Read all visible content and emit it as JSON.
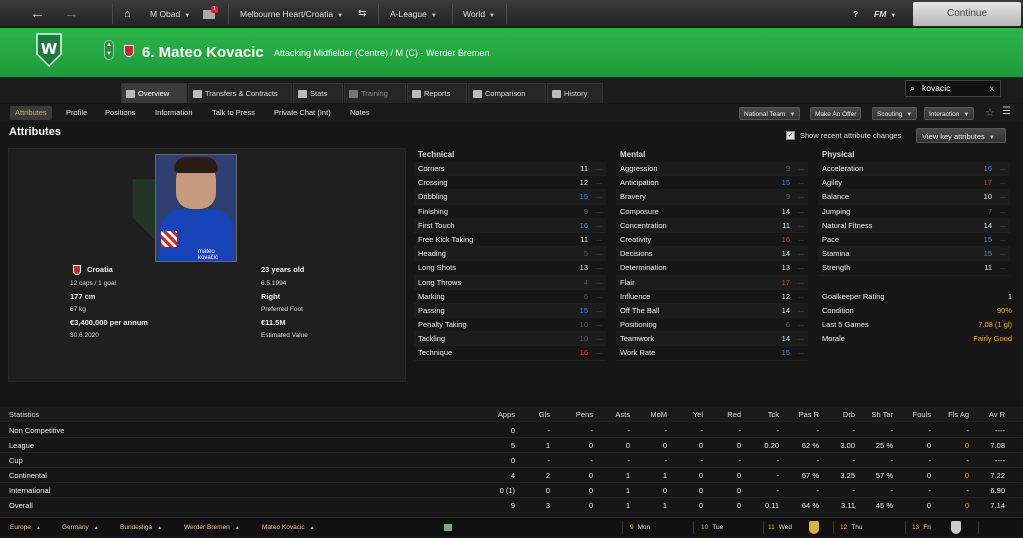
{
  "topbar": {
    "manager": "M Obad",
    "notif_count": "1",
    "club": "Melbourne Heart/Croatia",
    "competition": "A-League",
    "world": "World",
    "help": "?",
    "fm": "FM",
    "continue_label": "Continue"
  },
  "header": {
    "title": "6. Mateo Kovacic",
    "role": "Attacking Midfielder (Centre) / M (C) - Werder Bremen"
  },
  "tabs": [
    "Overview",
    "Transfers & Contracts",
    "Stats",
    "Training",
    "Reports",
    "Comparison",
    "History"
  ],
  "search": {
    "value": "kovacic",
    "clear": "x"
  },
  "subnav": [
    "Attributes",
    "Profile",
    "Positions",
    "Information",
    "Talk to Press",
    "Private Chat (Int)",
    "Notes"
  ],
  "actions": [
    "National Team",
    "Make An Offer",
    "Scouting",
    "Interaction"
  ],
  "attributes": {
    "title": "Attributes",
    "show_recent": "Show recent attribute changes",
    "view_key": "View key attributes"
  },
  "profile": {
    "photo_caption": "mateo kovačić",
    "nationality": "Croatia",
    "caps": "12 caps / 1 goal",
    "age": "23 years old",
    "dob": "6.5.1994",
    "height": "177 cm",
    "foot": "Right",
    "weight": "67 kg",
    "foot_label": "Preferred Foot",
    "wage": "€3,400,000 per annum",
    "value": "€11.5M",
    "contract": "30.6.2020",
    "value_label": "Estimated Value"
  },
  "technical": {
    "title": "Technical",
    "rows": [
      {
        "name": "Corners",
        "value": "11",
        "tone": "w"
      },
      {
        "name": "Crossing",
        "value": "12",
        "tone": "w"
      },
      {
        "name": "Dribbling",
        "value": "15",
        "tone": "b"
      },
      {
        "name": "Finishing",
        "value": "9",
        "tone": "g"
      },
      {
        "name": "First Touch",
        "value": "16",
        "tone": "b"
      },
      {
        "name": "Free Kick Taking",
        "value": "11",
        "tone": "w"
      },
      {
        "name": "Heading",
        "value": "5",
        "tone": "g"
      },
      {
        "name": "Long Shots",
        "value": "13",
        "tone": "w"
      },
      {
        "name": "Long Throws",
        "value": "4",
        "tone": "g"
      },
      {
        "name": "Marking",
        "value": "6",
        "tone": "g"
      },
      {
        "name": "Passing",
        "value": "15",
        "tone": "b"
      },
      {
        "name": "Penalty Taking",
        "value": "10",
        "tone": "g"
      },
      {
        "name": "Tackling",
        "value": "10",
        "tone": "g"
      },
      {
        "name": "Technique",
        "value": "16",
        "tone": "r"
      }
    ]
  },
  "mental": {
    "title": "Mental",
    "rows": [
      {
        "name": "Aggression",
        "value": "9",
        "tone": "g"
      },
      {
        "name": "Anticipation",
        "value": "15",
        "tone": "b"
      },
      {
        "name": "Bravery",
        "value": "9",
        "tone": "g"
      },
      {
        "name": "Composure",
        "value": "14",
        "tone": "w"
      },
      {
        "name": "Concentration",
        "value": "11",
        "tone": "w"
      },
      {
        "name": "Creativity",
        "value": "16",
        "tone": "r"
      },
      {
        "name": "Decisions",
        "value": "14",
        "tone": "w"
      },
      {
        "name": "Determination",
        "value": "13",
        "tone": "w"
      },
      {
        "name": "Flair",
        "value": "17",
        "tone": "r"
      },
      {
        "name": "Influence",
        "value": "12",
        "tone": "w"
      },
      {
        "name": "Off The Ball",
        "value": "14",
        "tone": "w"
      },
      {
        "name": "Positioning",
        "value": "6",
        "tone": "g"
      },
      {
        "name": "Teamwork",
        "value": "14",
        "tone": "w"
      },
      {
        "name": "Work Rate",
        "value": "15",
        "tone": "b"
      }
    ]
  },
  "physical": {
    "title": "Physical",
    "rows": [
      {
        "name": "Acceleration",
        "value": "16",
        "tone": "b"
      },
      {
        "name": "Agility",
        "value": "17",
        "tone": "r"
      },
      {
        "name": "Balance",
        "value": "10",
        "tone": "w"
      },
      {
        "name": "Jumping",
        "value": "7",
        "tone": "g"
      },
      {
        "name": "Natural Fitness",
        "value": "14",
        "tone": "w"
      },
      {
        "name": "Pace",
        "value": "15",
        "tone": "b"
      },
      {
        "name": "Stamina",
        "value": "15",
        "tone": "b"
      },
      {
        "name": "Strength",
        "value": "11",
        "tone": "w"
      }
    ],
    "extras": [
      {
        "name": "Goalkeeper Rating",
        "value": "1"
      },
      {
        "name": "Condition",
        "value": "90%"
      },
      {
        "name": "Last 5 Games",
        "value": "7.08 (1 gl)"
      },
      {
        "name": "Morale",
        "value": "Fairly Good"
      }
    ]
  },
  "statistics": {
    "title": "Statistics",
    "columns": [
      "Apps",
      "Gls",
      "Pens",
      "Asts",
      "MoM",
      "Yel",
      "Red",
      "Tck",
      "Pas R",
      "Drb",
      "Sh Tar",
      "Fouls",
      "Fls Ag",
      "Av R"
    ],
    "rows": [
      {
        "label": "Non Competitive",
        "cells": [
          "0",
          "-",
          "-",
          "-",
          "-",
          "-",
          "-",
          "-",
          "-",
          "-",
          "-",
          "-",
          "-",
          "----"
        ]
      },
      {
        "label": "League",
        "cells": [
          "5",
          "1",
          "0",
          "0",
          "0",
          "0",
          "0",
          "0.20",
          "62 %",
          "3.00",
          "25 %",
          "0",
          "0",
          "7.08"
        ]
      },
      {
        "label": "Cup",
        "cells": [
          "0",
          "-",
          "-",
          "-",
          "-",
          "-",
          "-",
          "-",
          "-",
          "-",
          "-",
          "-",
          "-",
          "----"
        ]
      },
      {
        "label": "Continental",
        "cells": [
          "4",
          "2",
          "0",
          "1",
          "1",
          "0",
          "0",
          "-",
          "67 %",
          "3.25",
          "57 %",
          "0",
          "0",
          "7.22"
        ]
      },
      {
        "label": "International",
        "cells": [
          "0 (1)",
          "0",
          "0",
          "1",
          "0",
          "0",
          "0",
          "-",
          "-",
          "-",
          "-",
          "-",
          "-",
          "6.90"
        ]
      },
      {
        "label": "Overall",
        "cells": [
          "9",
          "3",
          "0",
          "1",
          "1",
          "0",
          "0",
          "0.11",
          "64 %",
          "3.11",
          "45 %",
          "0",
          "0",
          "7.14"
        ]
      }
    ]
  },
  "footer": {
    "crumbs": [
      "Europe",
      "Germany",
      "Bundesliga",
      "Werder Bremen",
      "Mateo Kovacic"
    ],
    "days": [
      {
        "num": "9",
        "day": "Mon"
      },
      {
        "num": "10",
        "day": "Tue"
      },
      {
        "num": "11",
        "day": "Wed"
      },
      {
        "num": "12",
        "day": "Thu"
      },
      {
        "num": "13",
        "day": "Fri"
      }
    ]
  }
}
